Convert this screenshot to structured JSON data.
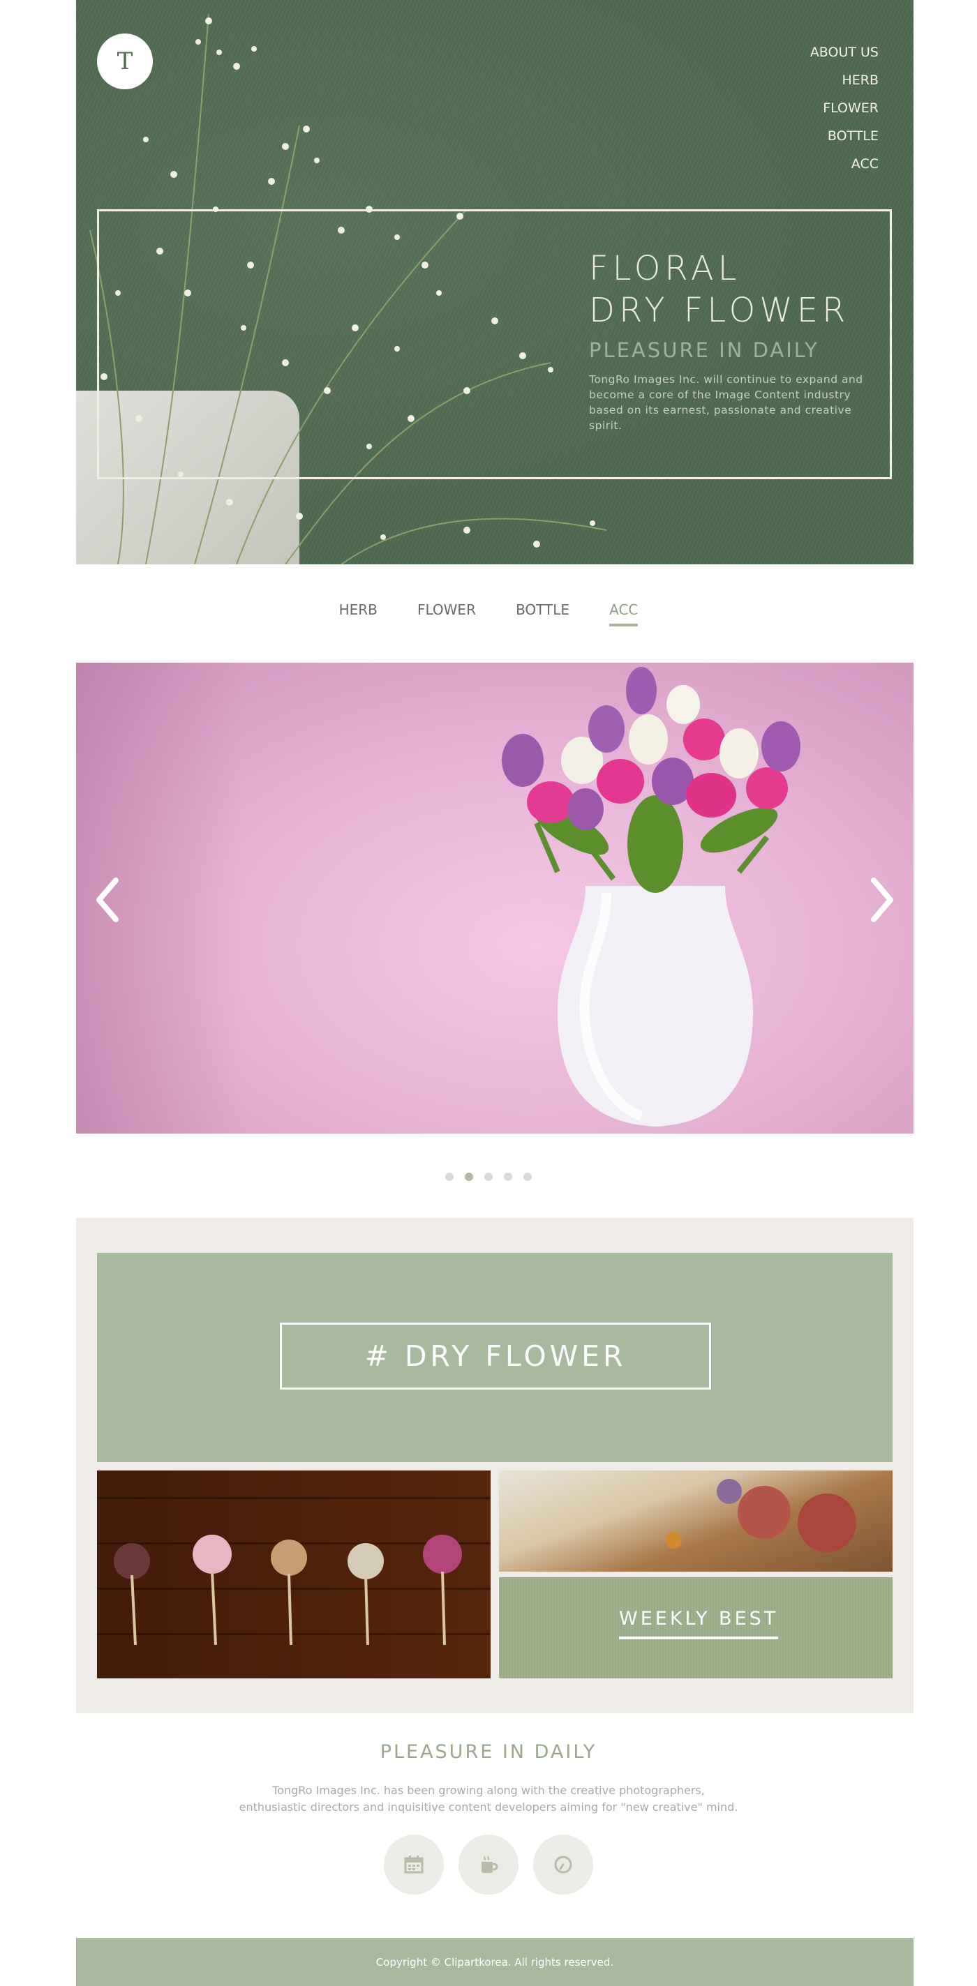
{
  "logo": {
    "letter": "T"
  },
  "top_nav": [
    {
      "label": "ABOUT US"
    },
    {
      "label": "HERB"
    },
    {
      "label": "FLOWER"
    },
    {
      "label": "BOTTLE"
    },
    {
      "label": "ACC"
    }
  ],
  "hero": {
    "title_line1": "FLORAL",
    "title_line2": "DRY FLOWER",
    "subtitle": "PLEASURE IN DAILY",
    "description": "TongRo Images Inc. will continue to expand and become a core of the Image Content industry based on its earnest, passionate and creative spirit."
  },
  "category_tabs": [
    {
      "label": "HERB",
      "active": false
    },
    {
      "label": "FLOWER",
      "active": false
    },
    {
      "label": "BOTTLE",
      "active": false
    },
    {
      "label": "ACC",
      "active": true
    }
  ],
  "slider": {
    "dot_count": 5,
    "active_dot": 2,
    "prev_icon": "chevron-left-icon",
    "next_icon": "chevron-right-icon"
  },
  "feature": {
    "banner_label": "# DRY FLOWER",
    "weekly_label": "WEEKLY BEST"
  },
  "pleasure": {
    "title": "PLEASURE IN DAILY",
    "line1": "TongRo Images Inc. has been growing along with the creative photographers,",
    "line2": "enthusiastic directors and inquisitive content developers aiming for \"new creative\" mind.",
    "icons": [
      "calendar-icon",
      "cup-icon",
      "clock-icon"
    ]
  },
  "footer": {
    "copyright": "Copyright © Clipartkorea. All rights reserved."
  },
  "colors": {
    "hero_green": "#4f6b50",
    "sage": "#a8b99e",
    "feature_bg": "#efece7",
    "pleasure_title": "#98a98b"
  }
}
